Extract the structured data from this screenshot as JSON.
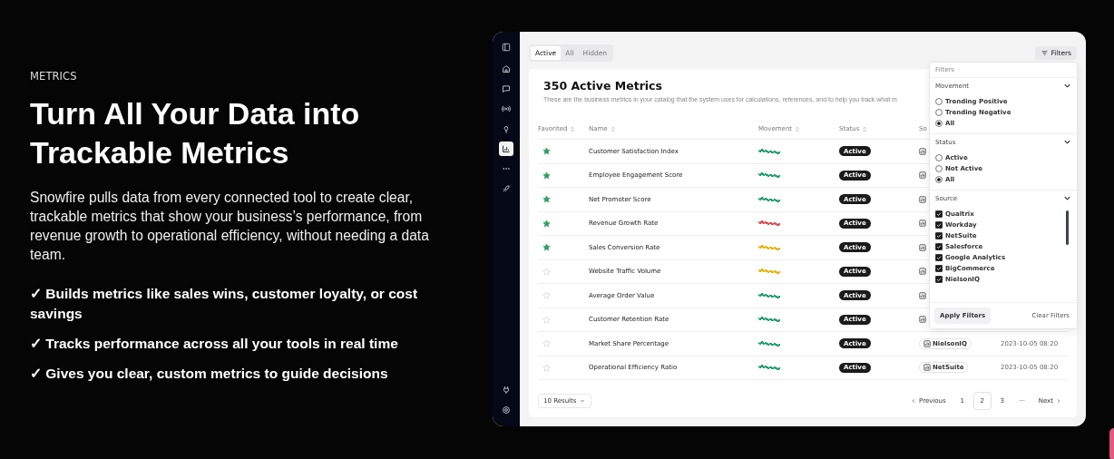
{
  "hero": {
    "eyebrow": "METRICS",
    "title": "Turn All Your Data into Trackable Metrics",
    "body": "Snowfire pulls data from every connected tool to create clear, trackable metrics that show your business’s performance, from revenue growth to operational efficiency, without needing a data team.",
    "bullets": [
      "✓ Builds metrics like sales wins, customer loyalty, or cost savings",
      "✓ Tracks performance across all your tools in real time",
      "✓ Gives you clear, custom metrics to guide decisions"
    ]
  },
  "sidebar": {
    "top": [
      {
        "selected": false
      }
    ],
    "items": [
      {
        "selected": false
      },
      {
        "selected": false
      },
      {
        "selected": false
      },
      {
        "selected": false
      },
      {
        "selected": true
      },
      {
        "selected": false
      },
      {
        "selected": false
      }
    ],
    "bottom": [
      {
        "selected": false
      },
      {
        "selected": false
      }
    ]
  },
  "tabs": [
    {
      "label": "Active",
      "selected": true
    },
    {
      "label": "All",
      "selected": false
    },
    {
      "label": "Hidden",
      "selected": false
    }
  ],
  "filters_button": "Filters",
  "card": {
    "title": "350 Active Metrics",
    "subtitle": "These are the business metrics in your catalog that the system uses for calculations, references, and to help you track what m"
  },
  "table": {
    "columns": [
      "Favorited",
      "Name",
      "Movement",
      "Status",
      "So"
    ],
    "rows": [
      {
        "favorited": true,
        "name": "Customer Satisfaction Index",
        "color": "#22a06b",
        "status": "Active"
      },
      {
        "favorited": true,
        "name": "Employee Engagement Score",
        "color": "#22a06b",
        "status": "Active"
      },
      {
        "favorited": true,
        "name": "Net Promoter Score",
        "color": "#22a06b",
        "status": "Active"
      },
      {
        "favorited": true,
        "name": "Revenue Growth Rate",
        "color": "#e5484d",
        "status": "Active"
      },
      {
        "favorited": true,
        "name": "Sales Conversion Rate",
        "color": "#e5b400",
        "status": "Active"
      },
      {
        "favorited": false,
        "name": "Website Traffic Volume",
        "color": "#e5b400",
        "status": "Active"
      },
      {
        "favorited": false,
        "name": "Average Order Value",
        "color": "#22a06b",
        "status": "Active"
      },
      {
        "favorited": false,
        "name": "Customer Retention Rate",
        "color": "#22a06b",
        "status": "Active"
      },
      {
        "favorited": false,
        "name": "Market Share Percentage",
        "color": "#22a06b",
        "status": "Active",
        "source": "NielsonIQ",
        "date": "2023-10-05 08:20"
      },
      {
        "favorited": false,
        "name": "Operational Efficiency Ratio",
        "color": "#22a06b",
        "status": "Active",
        "source": "NetSuite",
        "date": "2023-10-05 08:20"
      }
    ]
  },
  "results_select": "10 Results",
  "pagination": {
    "previous": "Previous",
    "next": "Next",
    "pages": [
      {
        "label": "1",
        "selected": false
      },
      {
        "label": "2",
        "selected": true
      },
      {
        "label": "3",
        "selected": false
      },
      {
        "label": "···",
        "selected": false
      }
    ]
  },
  "filters_panel": {
    "title": "Filters",
    "sections": [
      {
        "title": "Movement",
        "kind": "radio",
        "options": [
          {
            "label": "Trending Positive",
            "selected": false
          },
          {
            "label": "Trending Negative",
            "selected": false
          },
          {
            "label": "All",
            "selected": true
          }
        ]
      },
      {
        "title": "Status",
        "kind": "radio",
        "options": [
          {
            "label": "Active",
            "selected": false
          },
          {
            "label": "Not Active",
            "selected": false
          },
          {
            "label": "All",
            "selected": true
          }
        ]
      },
      {
        "title": "Source",
        "kind": "checkbox",
        "options": [
          {
            "label": "Qualtrix",
            "checked": true
          },
          {
            "label": "Workday",
            "checked": true
          },
          {
            "label": "NetSuite",
            "checked": true
          },
          {
            "label": "Salesforce",
            "checked": true
          },
          {
            "label": "Google Analytics",
            "checked": true
          },
          {
            "label": "BigCommerce",
            "checked": true
          },
          {
            "label": "NielsonIQ",
            "checked": true
          }
        ]
      }
    ],
    "apply": "Apply Filters",
    "clear": "Clear Filters"
  }
}
